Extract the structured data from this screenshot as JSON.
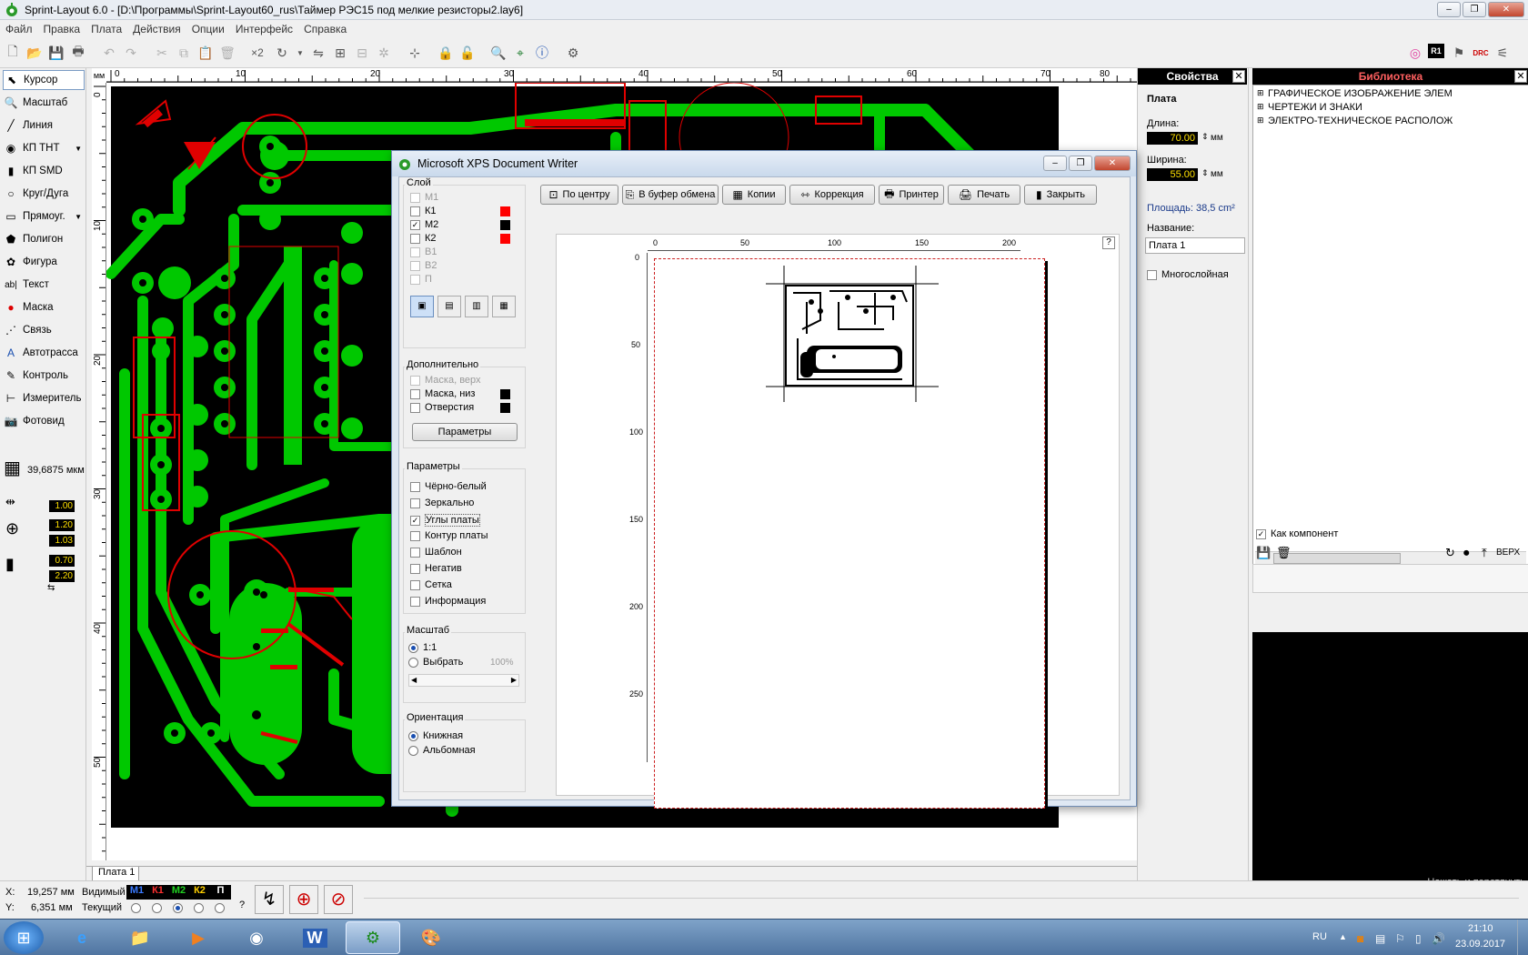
{
  "window": {
    "title": "Sprint-Layout 6.0 - [D:\\Программы\\Sprint-Layout60_rus\\Таймер РЭС15 под мелкие резисторы2.lay6]",
    "min": "–",
    "max": "❐",
    "close": "✕"
  },
  "menu": [
    "Файл",
    "Правка",
    "Плата",
    "Действия",
    "Опции",
    "Интерфейс",
    "Справка"
  ],
  "toolbar": {
    "x2_label": "×2"
  },
  "tools": [
    {
      "label": "Курсор",
      "icon": "cursor-icon"
    },
    {
      "label": "Масштаб",
      "icon": "zoom-icon"
    },
    {
      "label": "Линия",
      "icon": "line-icon"
    },
    {
      "label": "КП THT",
      "icon": "tht-pad-icon"
    },
    {
      "label": "КП SMD",
      "icon": "smd-pad-icon"
    },
    {
      "label": "Круг/Дуга",
      "icon": "circle-icon"
    },
    {
      "label": "Прямоуг.",
      "icon": "rect-icon"
    },
    {
      "label": "Полигон",
      "icon": "polygon-icon"
    },
    {
      "label": "Фигура",
      "icon": "shape-icon"
    },
    {
      "label": "Текст",
      "icon": "text-icon"
    },
    {
      "label": "Маска",
      "icon": "mask-icon"
    },
    {
      "label": "Связь",
      "icon": "connection-icon"
    },
    {
      "label": "Автотрасса",
      "icon": "autoroute-icon"
    },
    {
      "label": "Контроль",
      "icon": "check-icon"
    },
    {
      "label": "Измеритель",
      "icon": "measure-icon"
    },
    {
      "label": "Фотовид",
      "icon": "photoview-icon"
    }
  ],
  "grid_value": "39,6875 мкм",
  "track": {
    "width": "1.00",
    "pad_outer": "1.20",
    "pad_inner": "1.03",
    "smd_w": "0.70",
    "smd_h": "2.20"
  },
  "ruler": {
    "unit": "мм",
    "h": [
      "0",
      "10",
      "20",
      "30",
      "40",
      "50",
      "60",
      "70",
      "80"
    ],
    "v": [
      "0",
      "10",
      "20",
      "30",
      "40",
      "50"
    ]
  },
  "properties": {
    "title": "Свойства",
    "section": "Плата",
    "length_label": "Длина:",
    "length": "70.00",
    "unit": "мм",
    "width_label": "Ширина:",
    "width": "55.00",
    "area": "Площадь:   38,5 cm²",
    "name_label": "Название:",
    "name": "Плата 1",
    "multilayer": "Многослойная"
  },
  "library": {
    "title": "Библиотека",
    "items": [
      "ГРАФИЧЕСКОЕ ИЗОБРАЖЕНИЕ ЭЛЕМ",
      "ЧЕРТЕЖИ И ЗНАКИ",
      "ЭЛЕКТРО-ТЕХНИЧЕСКОЕ РАСПОЛОЖ"
    ],
    "as_component": "Как компонент",
    "side": "ВЕРХ",
    "hint": "Нажать и перетянуть"
  },
  "tab": "Плата 1",
  "status": {
    "x_label": "X:",
    "x": "19,257 мм",
    "y_label": "Y:",
    "y": "6,351 мм",
    "visible": "Видимый",
    "current": "Текущий",
    "layers": [
      "М1",
      "К1",
      "М2",
      "К2",
      "П"
    ],
    "question": "?"
  },
  "dialog": {
    "title": "Microsoft XPS Document Writer",
    "layer_title": "Слой",
    "layers": [
      "М1",
      "К1",
      "М2",
      "К2",
      "В1",
      "В2",
      "П"
    ],
    "extra_title": "Дополнительно",
    "extra": [
      "Маска, верх",
      "Маска, низ",
      "Отверстия"
    ],
    "params_button": "Параметры",
    "params_title": "Параметры",
    "params": [
      "Чёрно-белый",
      "Зеркально",
      "Углы платы",
      "Контур платы",
      "Шаблон",
      "Негатив",
      "Сетка",
      "Информация"
    ],
    "scale_title": "Масштаб",
    "scale_opts": [
      "1:1",
      "Выбрать"
    ],
    "scale_percent": "100%",
    "orient_title": "Ориентация",
    "orient_opts": [
      "Книжная",
      "Альбомная"
    ],
    "buttons": [
      "По центру",
      "В буфер обмена",
      "Копии",
      "Коррекция",
      "Принтер",
      "Печать",
      "Закрыть"
    ],
    "help": "?",
    "preview_ruler_h": [
      "0",
      "50",
      "100",
      "150",
      "200"
    ],
    "preview_ruler_v": [
      "0",
      "50",
      "100",
      "150",
      "200",
      "250"
    ]
  },
  "taskbar": {
    "lang": "RU",
    "time": "21:10",
    "date": "23.09.2017"
  },
  "colors": {
    "pcb_bg": "#000000",
    "copper": "#00c800",
    "silk": "#e00000",
    "accent": "#1a4fb0"
  }
}
